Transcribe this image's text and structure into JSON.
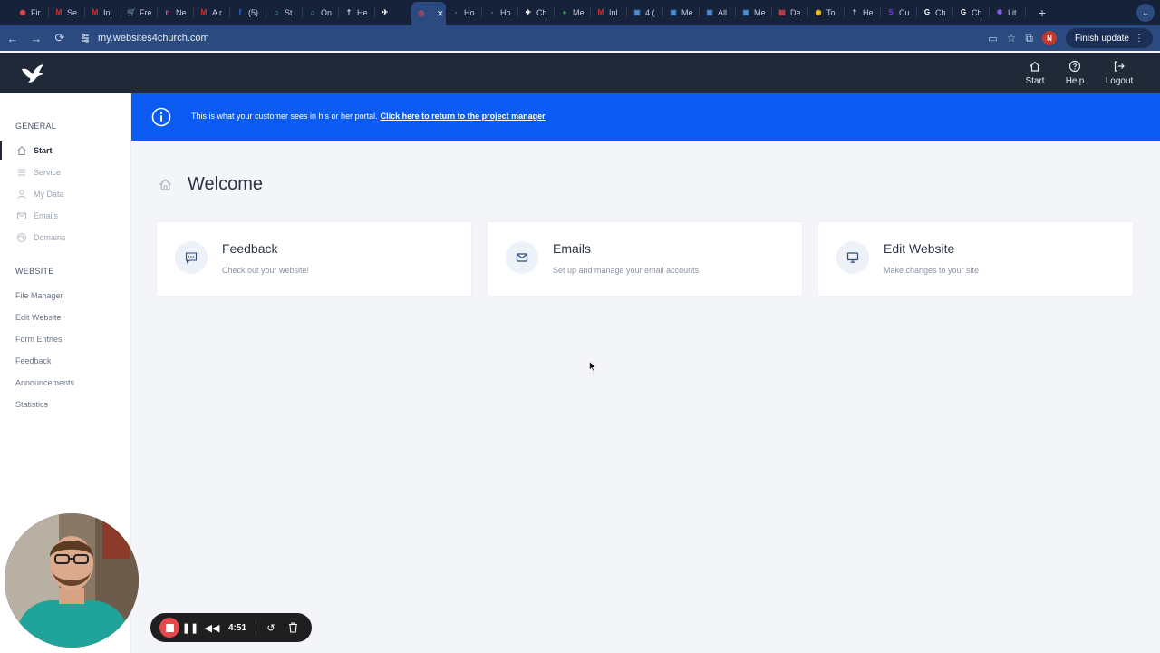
{
  "browser": {
    "tabs": [
      {
        "label": "Fir",
        "color": "#e5484d",
        "glyph": "◉"
      },
      {
        "label": "Se",
        "color": "#d93025",
        "glyph": "M"
      },
      {
        "label": "Inl",
        "color": "#d93025",
        "glyph": "M"
      },
      {
        "label": "Fre",
        "color": "#3b82f6",
        "glyph": "🛒"
      },
      {
        "label": "Ne",
        "color": "#e0569b",
        "glyph": "n"
      },
      {
        "label": "A r",
        "color": "#d93025",
        "glyph": "M"
      },
      {
        "label": "(5)",
        "color": "#1877f2",
        "glyph": "f"
      },
      {
        "label": "St",
        "color": "#3ba7a0",
        "glyph": "⌂"
      },
      {
        "label": "On",
        "color": "#3ba7a0",
        "glyph": "⌂"
      },
      {
        "label": "He",
        "color": "#ffffff",
        "glyph": "†"
      },
      {
        "label": "",
        "color": "#ffffff",
        "glyph": "✈"
      },
      {
        "label": "",
        "color": "#e5484d",
        "glyph": "◎"
      },
      {
        "label": "Ho",
        "color": "#6b7da6",
        "glyph": "-"
      },
      {
        "label": "Ho",
        "color": "#6b7da6",
        "glyph": "-"
      },
      {
        "label": "Ch",
        "color": "#ffffff",
        "glyph": "✈"
      },
      {
        "label": "Me",
        "color": "#34a853",
        "glyph": "●"
      },
      {
        "label": "Inl",
        "color": "#d93025",
        "glyph": "M"
      },
      {
        "label": "4 (",
        "color": "#4a90d9",
        "glyph": "▣"
      },
      {
        "label": "Me",
        "color": "#4a90d9",
        "glyph": "▣"
      },
      {
        "label": "All",
        "color": "#4a90d9",
        "glyph": "▣"
      },
      {
        "label": "Me",
        "color": "#4a90d9",
        "glyph": "▣"
      },
      {
        "label": "De",
        "color": "#e5484d",
        "glyph": "▤"
      },
      {
        "label": "To",
        "color": "#f5c518",
        "glyph": "◉"
      },
      {
        "label": "He",
        "color": "#ffffff",
        "glyph": "†"
      },
      {
        "label": "Cu",
        "color": "#7c3aed",
        "glyph": "S"
      },
      {
        "label": "Ch",
        "color": "#ffffff",
        "glyph": "G"
      },
      {
        "label": "Ch",
        "color": "#ffffff",
        "glyph": "G"
      },
      {
        "label": "Lit",
        "color": "#8b5cf6",
        "glyph": "✱"
      }
    ],
    "url": "my.websites4church.com",
    "profile_initial": "N",
    "finish_update": "Finish update"
  },
  "header": {
    "nav": [
      {
        "label": "Start",
        "icon": "home-icon"
      },
      {
        "label": "Help",
        "icon": "help-icon"
      },
      {
        "label": "Logout",
        "icon": "logout-icon"
      }
    ]
  },
  "sidebar": {
    "general_title": "GENERAL",
    "general_items": [
      {
        "label": "Start",
        "icon": "home-icon"
      },
      {
        "label": "Service",
        "icon": "list-icon"
      },
      {
        "label": "My Data",
        "icon": "user-icon"
      },
      {
        "label": "Emails",
        "icon": "mail-icon"
      },
      {
        "label": "Domains",
        "icon": "globe-icon"
      }
    ],
    "website_title": "WEBSITE",
    "website_items": [
      {
        "label": "File Manager"
      },
      {
        "label": "Edit Website"
      },
      {
        "label": "Form Entries"
      },
      {
        "label": "Feedback"
      },
      {
        "label": "Announcements"
      },
      {
        "label": "Statistics"
      }
    ]
  },
  "banner": {
    "text": "This is what your customer sees in his or her portal.",
    "link": "Click here to return to the project manager"
  },
  "main": {
    "title": "Welcome",
    "cards": [
      {
        "title": "Feedback",
        "desc": "Check out your website!",
        "icon": "chat-icon"
      },
      {
        "title": "Emails",
        "desc": "Set up and manage your email accounts",
        "icon": "mail-icon"
      },
      {
        "title": "Edit Website",
        "desc": "Make changes to your site",
        "icon": "monitor-icon"
      }
    ]
  },
  "recorder": {
    "time": "4:51"
  },
  "colors": {
    "banner": "#0b5af2",
    "header": "#1f2937",
    "record": "#e5484d"
  }
}
